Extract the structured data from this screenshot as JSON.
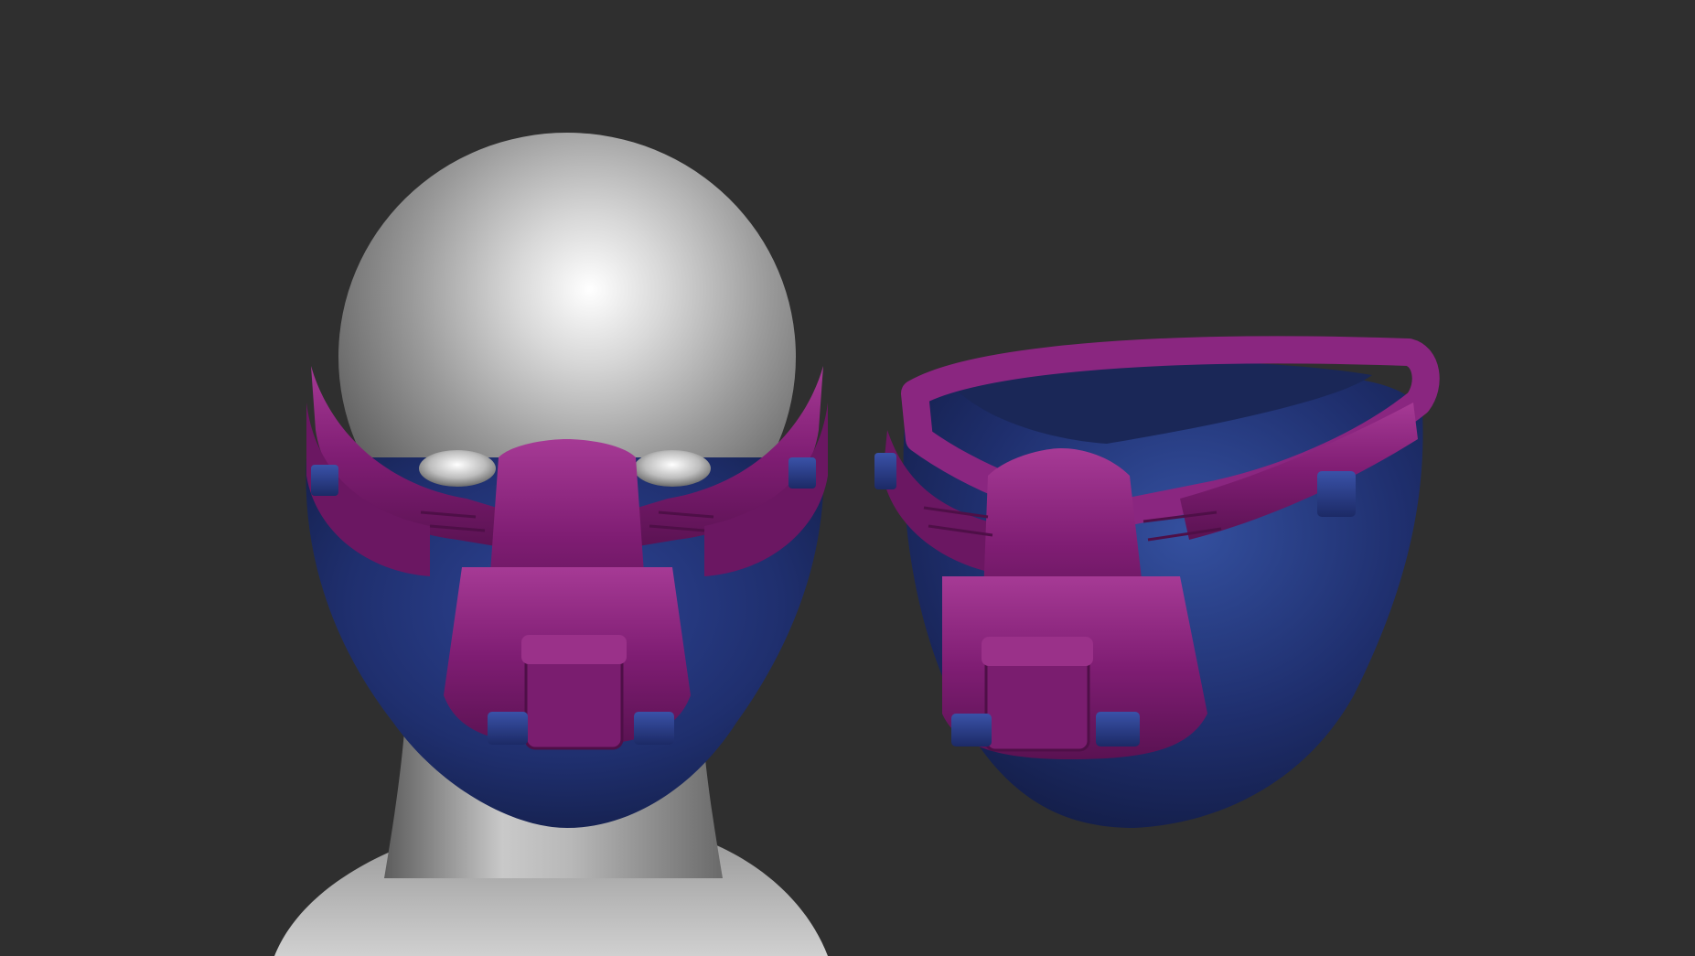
{
  "scene": {
    "background_color": "#2f2f2f",
    "objects": [
      {
        "name": "head-with-mask-front-view",
        "icon": "sculpt-head-icon"
      },
      {
        "name": "mask-three-quarter-view",
        "icon": "sculpt-mask-icon"
      }
    ]
  },
  "colors": {
    "background": "#2f2f2f",
    "skin_light": "#f2f2f2",
    "skin_mid": "#a8a8a8",
    "skin_dark": "#5a5a5a",
    "mask_purple": "#7a1a6e",
    "mask_purple_light": "#a0358f",
    "mask_purple_dark": "#4e0f47",
    "mask_navy": "#1f2f6e",
    "mask_navy_light": "#2e4596",
    "mask_navy_dark": "#141f4a",
    "clip_blue": "#2b3f8f"
  }
}
